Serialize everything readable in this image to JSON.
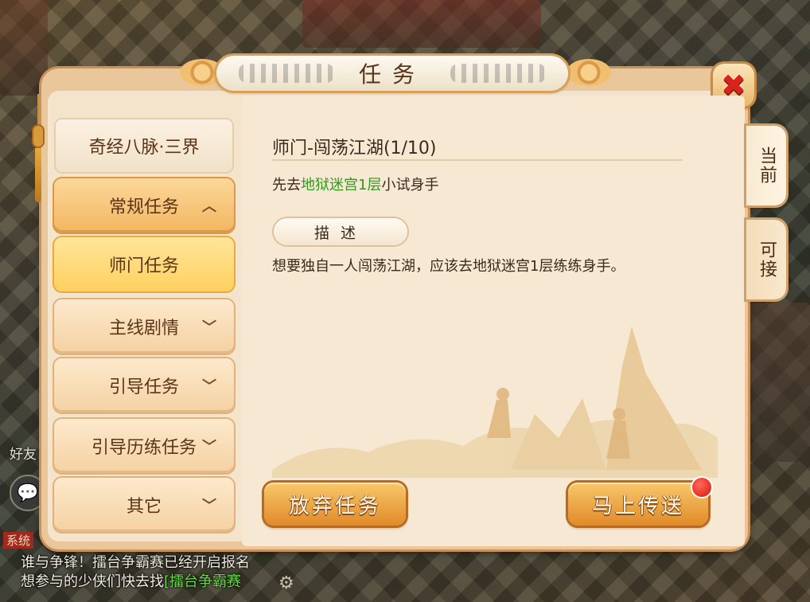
{
  "window": {
    "title": "任务",
    "close_glyph": "✖"
  },
  "side_tabs": {
    "current": "当前",
    "available": "可接"
  },
  "menu": {
    "header": "奇经八脉·三界",
    "items": [
      {
        "label": "常规任务",
        "chevron": "︿",
        "state": "expanded"
      },
      {
        "label": "师门任务",
        "chevron": "",
        "state": "selected"
      },
      {
        "label": "主线剧情",
        "chevron": "﹀",
        "state": "collapsed"
      },
      {
        "label": "引导任务",
        "chevron": "﹀",
        "state": "collapsed"
      },
      {
        "label": "引导历练任务",
        "chevron": "﹀",
        "state": "collapsed"
      },
      {
        "label": "其它",
        "chevron": "﹀",
        "state": "collapsed"
      }
    ]
  },
  "quest": {
    "title": "师门-闯荡江湖(1/10)",
    "goal_prefix": "先去",
    "goal_location": "地狱迷宫1层",
    "goal_suffix": "小试身手",
    "description_label": "描述",
    "description": "想要独自一人闯荡江湖，应该去地狱迷宫1层练练身手。"
  },
  "buttons": {
    "abandon": "放弃任务",
    "teleport": "马上传送"
  },
  "hud": {
    "friends": "好友",
    "system_tag": "系统",
    "chat_line1": "谁与争锋！擂台争霸赛已经开启报名",
    "chat_line2_prefix": "想参与的少侠们快去找",
    "chat_line2_link": "[擂台争霸赛",
    "chat_icon": "💬",
    "gear_icon": "⚙"
  },
  "colors": {
    "location_highlight": "#2e9a1e",
    "close_red": "#d8241a",
    "notification_dot": "#d8140e"
  }
}
